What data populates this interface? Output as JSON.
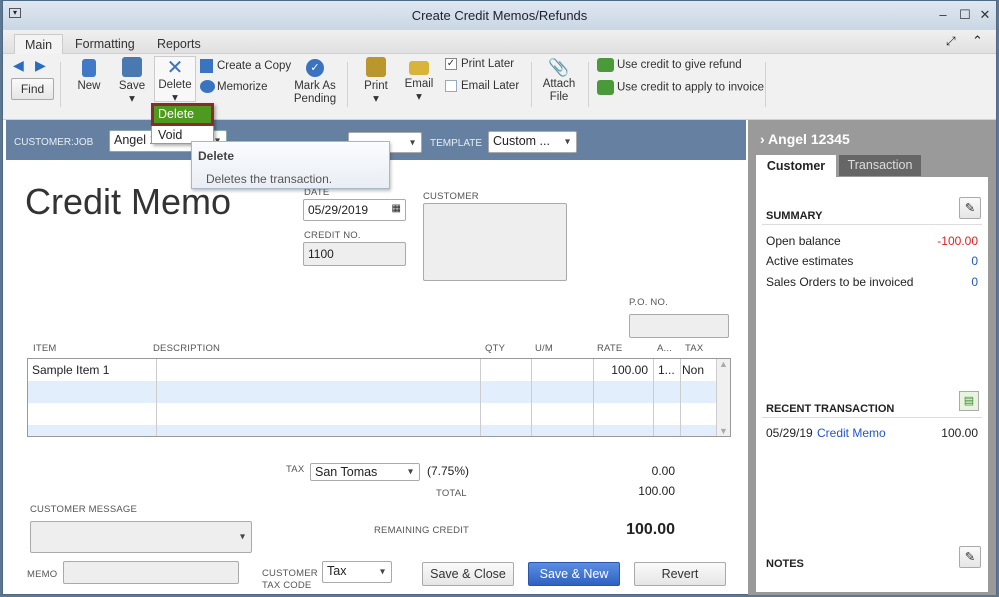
{
  "window": {
    "title": "Create Credit Memos/Refunds"
  },
  "tabs": [
    "Main",
    "Formatting",
    "Reports"
  ],
  "ribbon": {
    "find": "Find",
    "new": "New",
    "save": "Save",
    "delete": "Delete",
    "create_copy": "Create a Copy",
    "memorize": "Memorize",
    "mark_as_pending": [
      "Mark As",
      "Pending"
    ],
    "print": "Print",
    "email": "Email",
    "print_later": "Print Later",
    "print_later_checked": true,
    "email_later": "Email Later",
    "email_later_checked": false,
    "attach_file": [
      "Attach",
      "File"
    ],
    "use_credit_refund": "Use credit to give refund",
    "use_credit_invoice": "Use credit to apply to invoice"
  },
  "delete_menu": {
    "items": [
      "Delete",
      "Void"
    ],
    "tooltip_title": "Delete",
    "tooltip_text": "Deletes the transaction."
  },
  "header": {
    "customer_job_label": "CUSTOMER:JOB",
    "customer_job_value": "Angel 1...",
    "template_label": "TEMPLATE",
    "template_value": "Custom ..."
  },
  "form": {
    "title": "Credit Memo",
    "date_label": "DATE",
    "date_value": "05/29/2019",
    "credit_no_label": "CREDIT NO.",
    "credit_no_value": "1100",
    "customer_label": "CUSTOMER",
    "po_label": "P.O. NO."
  },
  "table": {
    "columns": [
      "ITEM",
      "DESCRIPTION",
      "QTY",
      "U/M",
      "RATE",
      "A...",
      "TAX"
    ],
    "rows": [
      {
        "item": "Sample Item 1",
        "description": "",
        "qty": "",
        "um": "",
        "rate": "100.00",
        "amount": "1...",
        "tax": "Non"
      }
    ]
  },
  "totals": {
    "tax_label": "TAX",
    "tax_item": "San Tomas",
    "tax_rate": "(7.75%)",
    "tax_amount": "0.00",
    "total_label": "TOTAL",
    "total": "100.00",
    "remaining_label": "REMAINING CREDIT",
    "remaining": "100.00"
  },
  "footer": {
    "customer_message_label": "CUSTOMER MESSAGE",
    "memo_label": "MEMO",
    "tax_code_label": [
      "CUSTOMER",
      "TAX CODE"
    ],
    "tax_code_value": "Tax",
    "save_close": "Save & Close",
    "save_new": "Save & New",
    "revert": "Revert"
  },
  "panel": {
    "name": "Angel 12345",
    "tabs": [
      "Customer",
      "Transaction"
    ],
    "summary_title": "SUMMARY",
    "summary": [
      {
        "label": "Open balance",
        "value": "-100.00"
      },
      {
        "label": "Active estimates",
        "value": "0"
      },
      {
        "label": "Sales Orders to be invoiced",
        "value": "0"
      }
    ],
    "recent_title": "RECENT TRANSACTION",
    "recent": {
      "date": "05/29/19",
      "type": "Credit Memo",
      "amount": "100.00"
    },
    "notes_title": "NOTES"
  },
  "colors": {
    "accent": "#3b6fc9",
    "negative": "#e02020",
    "header": "#6580a0",
    "menu_highlight": "#4c9a1e"
  }
}
